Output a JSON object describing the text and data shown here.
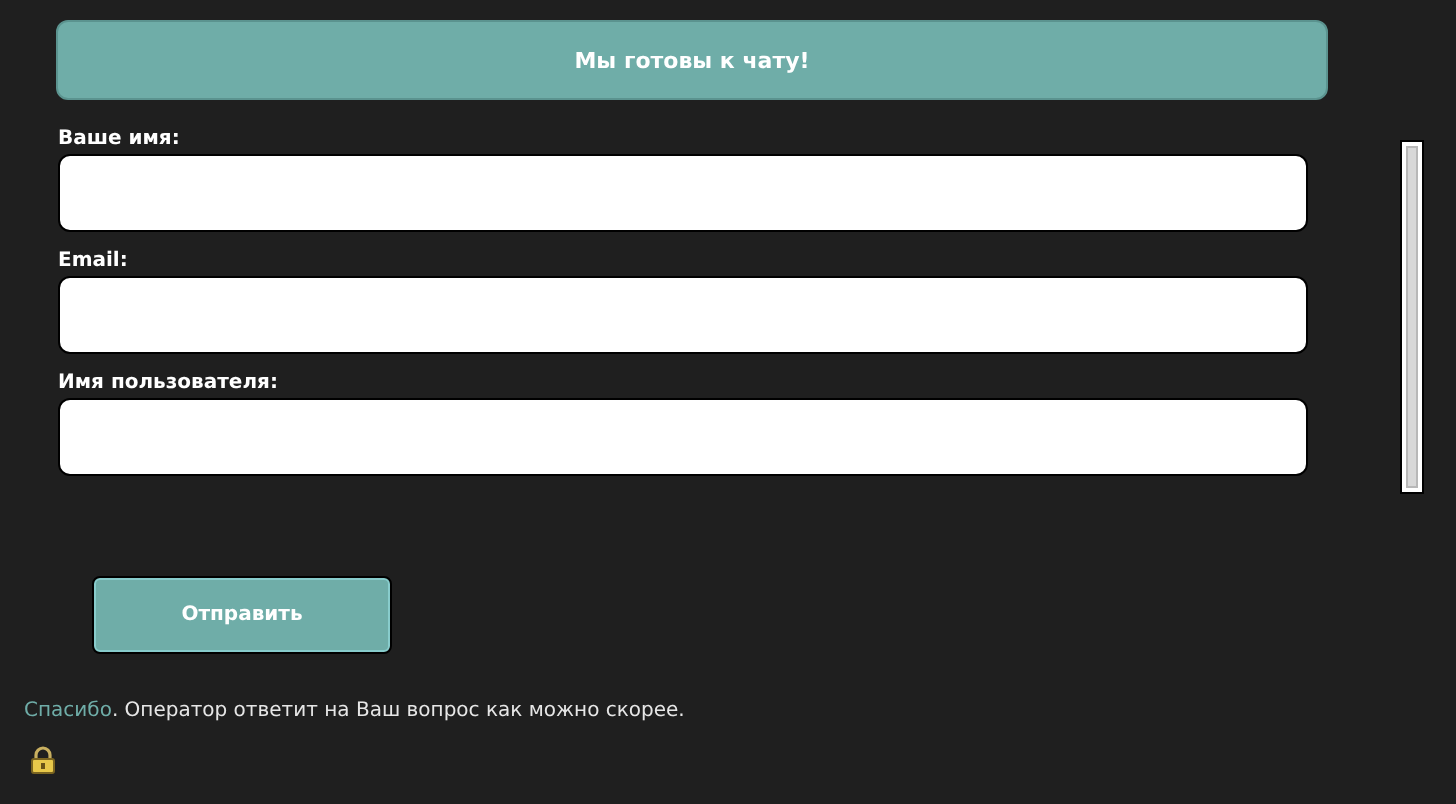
{
  "header": {
    "title": "Мы готовы к чату!"
  },
  "fields": [
    {
      "label": "Ваше имя:"
    },
    {
      "label": "Email:"
    },
    {
      "label": "Имя пользователя:"
    }
  ],
  "submit": {
    "label": "Отправить"
  },
  "footer": {
    "link": "Спасибо",
    "text": ". Оператор ответит на Ваш вопрос как можно скорее."
  }
}
